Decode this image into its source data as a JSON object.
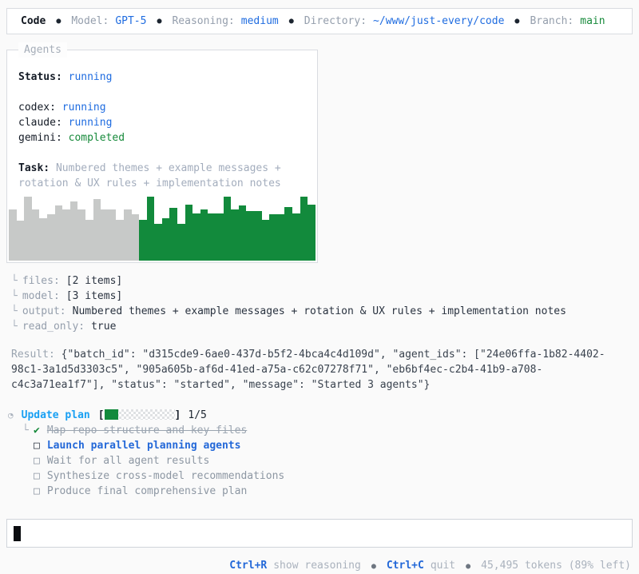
{
  "header": {
    "app_name": "Code",
    "separator": "●",
    "model_label": "Model:",
    "model_value": "GPT-5",
    "reasoning_label": "Reasoning:",
    "reasoning_value": "medium",
    "directory_label": "Directory:",
    "directory_value": "~/www/just-every/code",
    "branch_label": "Branch:",
    "branch_value": "main"
  },
  "agents_panel": {
    "title": "Agents",
    "status_label": "Status:",
    "status_value": "running",
    "agents": [
      {
        "name": "codex:",
        "state": "running"
      },
      {
        "name": "claude:",
        "state": "running"
      },
      {
        "name": "gemini:",
        "state": "completed"
      }
    ],
    "task_label": "Task:",
    "task_text": "Numbered themes + example messages + rotation & UX rules + implementation notes",
    "chart_data": {
      "type": "bar",
      "title": "agent activity sparkline",
      "values": [
        0.8,
        0.62,
        1.0,
        0.8,
        0.66,
        0.72,
        0.86,
        0.8,
        0.92,
        0.8,
        0.64,
        0.96,
        0.8,
        0.8,
        0.64,
        0.8,
        0.72,
        0.64,
        1.0,
        0.58,
        0.66,
        0.82,
        0.58,
        0.88,
        0.74,
        0.8,
        0.74,
        0.74,
        1.0,
        0.8,
        0.86,
        0.78,
        0.78,
        0.64,
        0.72,
        0.72,
        0.84,
        0.74,
        1.0,
        0.88
      ],
      "gray_count": 17,
      "ylim": [
        0,
        1
      ],
      "colors": {
        "past": "#c7c9c8",
        "active": "#128a3c"
      }
    }
  },
  "tool_output": {
    "branch_glyph": "└",
    "rows": [
      {
        "key": "files:",
        "value": "[2 items]"
      },
      {
        "key": "model:",
        "value": "[3 items]"
      },
      {
        "key": "output:",
        "value": "Numbered themes + example messages + rotation & UX rules + implementation notes"
      },
      {
        "key": "read_only:",
        "value": "true"
      }
    ]
  },
  "result": {
    "label": "Result:",
    "value": "{\"batch_id\": \"d315cde9-6ae0-437d-b5f2-4bca4c4d109d\", \"agent_ids\": [\"24e06ffa-1b82-4402-98c1-3a1d5d3303c5\", \"905a605b-af6d-41ed-a75a-c62c07278f71\", \"eb6bf4ec-c2b4-41b9-a708-c4c3a71ea1f7\"], \"status\": \"started\", \"message\": \"Started 3 agents\"}"
  },
  "plan": {
    "spinner_icon": "◔",
    "title": "Update plan",
    "open_bracket": "[",
    "close_bracket": "]",
    "progress_percent": 20,
    "progress_label": "1/5",
    "branch_glyph": "└",
    "items": [
      {
        "glyph": "✔",
        "label": "Map repo structure and key files",
        "state": "done"
      },
      {
        "glyph": "□",
        "label": "Launch parallel planning agents",
        "state": "active"
      },
      {
        "glyph": "□",
        "label": "Wait for all agent results",
        "state": "pending"
      },
      {
        "glyph": "□",
        "label": "Synthesize cross-model recommendations",
        "state": "pending"
      },
      {
        "glyph": "□",
        "label": "Produce final comprehensive plan",
        "state": "pending"
      }
    ]
  },
  "composer": {
    "value": ""
  },
  "footer": {
    "shortcut1_key": "Ctrl+R",
    "shortcut1_label": "show reasoning",
    "separator": "●",
    "shortcut2_key": "Ctrl+C",
    "shortcut2_label": "quit",
    "tokens_text": "45,495 tokens (89% left)"
  }
}
